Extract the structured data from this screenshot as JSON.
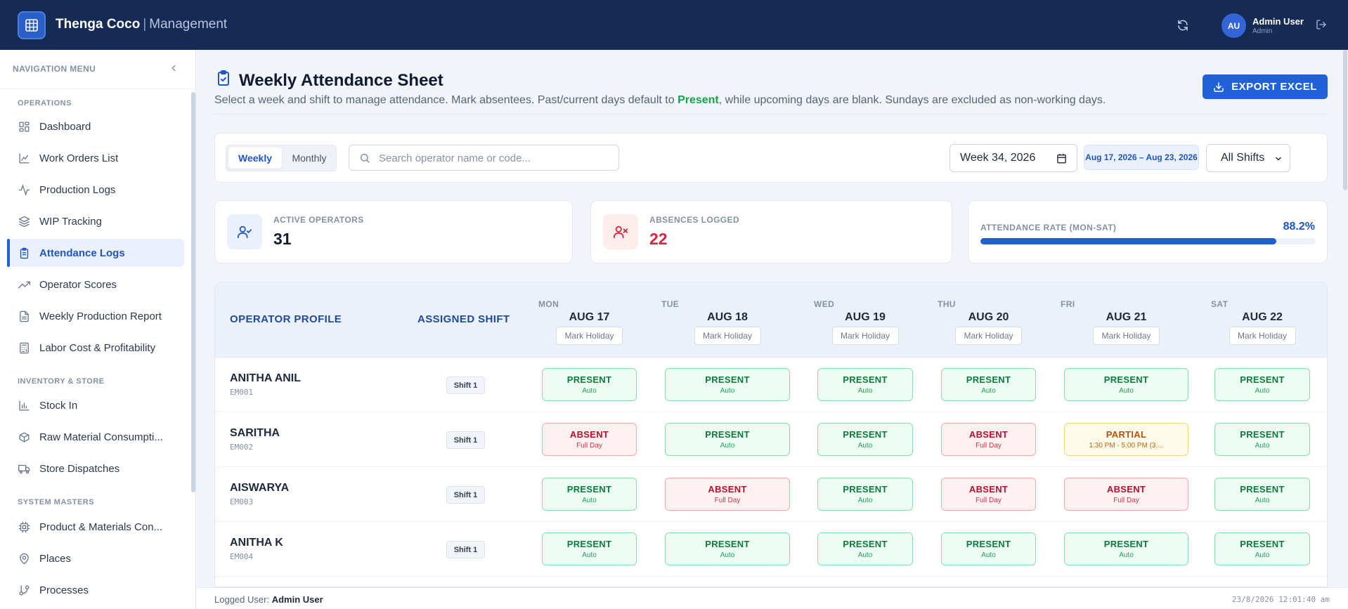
{
  "header": {
    "brand": "Thenga Coco",
    "separator": "|",
    "subtitle": "Management",
    "user_initials": "AU",
    "user_name": "Admin User",
    "user_role": "Admin"
  },
  "sidebar": {
    "title": "NAVIGATION MENU",
    "sections": {
      "operations": "OPERATIONS",
      "inventory": "INVENTORY & STORE",
      "masters": "SYSTEM MASTERS"
    },
    "items": [
      {
        "label": "Dashboard",
        "icon": "dashboard-icon"
      },
      {
        "label": "Work Orders List",
        "icon": "chart-area-icon"
      },
      {
        "label": "Production Logs",
        "icon": "activity-icon"
      },
      {
        "label": "WIP Tracking",
        "icon": "layers-icon"
      },
      {
        "label": "Attendance Logs",
        "icon": "clipboard-icon",
        "active": true
      },
      {
        "label": "Operator Scores",
        "icon": "trending-up-icon"
      },
      {
        "label": "Weekly Production Report",
        "icon": "file-text-icon"
      },
      {
        "label": "Labor Cost & Profitability",
        "icon": "calculator-icon"
      },
      {
        "label": "Stock In",
        "icon": "bar-chart-icon"
      },
      {
        "label": "Raw Material Consumpti...",
        "icon": "package-icon"
      },
      {
        "label": "Store Dispatches",
        "icon": "truck-icon"
      },
      {
        "label": "Product & Materials Con...",
        "icon": "cpu-icon"
      },
      {
        "label": "Places",
        "icon": "map-pin-icon"
      },
      {
        "label": "Processes",
        "icon": "git-branch-icon"
      }
    ]
  },
  "page": {
    "title": "Weekly Attendance Sheet",
    "desc_pre": "Select a week and shift to manage attendance. Mark absentees. Past/current days default to ",
    "desc_highlight": "Present",
    "desc_post": ", while upcoming days are blank. Sundays are excluded as non-working days.",
    "export_label": "EXPORT EXCEL"
  },
  "filters": {
    "view_weekly": "Weekly",
    "view_monthly": "Monthly",
    "search_placeholder": "Search operator name or code...",
    "week_value": "Week 34, 2026",
    "date_range": "Aug 17, 2026 – Aug 23, 2026",
    "shift_value": "All Shifts"
  },
  "stats": {
    "active_label": "ACTIVE OPERATORS",
    "active_value": "31",
    "absences_label": "ABSENCES LOGGED",
    "absences_value": "22",
    "rate_label": "ATTENDANCE RATE (MON-SAT)",
    "rate_value": "88.2%",
    "rate_fraction": 0.882
  },
  "table": {
    "col_operator": "OPERATOR PROFILE",
    "col_shift": "ASSIGNED SHIFT",
    "holiday_label": "Mark Holiday",
    "days": [
      {
        "name": "MON",
        "date": "AUG 17"
      },
      {
        "name": "TUE",
        "date": "AUG 18"
      },
      {
        "name": "WED",
        "date": "AUG 19"
      },
      {
        "name": "THU",
        "date": "AUG 20"
      },
      {
        "name": "FRI",
        "date": "AUG 21"
      },
      {
        "name": "SAT",
        "date": "AUG 22"
      }
    ],
    "rows": [
      {
        "name": "ANITHA ANIL",
        "code": "EM001",
        "shift": "Shift 1",
        "cells": [
          {
            "status": "PRESENT",
            "note": "Auto",
            "kind": "present"
          },
          {
            "status": "PRESENT",
            "note": "Auto",
            "kind": "present"
          },
          {
            "status": "PRESENT",
            "note": "Auto",
            "kind": "present"
          },
          {
            "status": "PRESENT",
            "note": "Auto",
            "kind": "present"
          },
          {
            "status": "PRESENT",
            "note": "Auto",
            "kind": "present"
          },
          {
            "status": "PRESENT",
            "note": "Auto",
            "kind": "present"
          }
        ]
      },
      {
        "name": "SARITHA",
        "code": "EM002",
        "shift": "Shift 1",
        "cells": [
          {
            "status": "ABSENT",
            "note": "Full Day",
            "kind": "absent"
          },
          {
            "status": "PRESENT",
            "note": "Auto",
            "kind": "present"
          },
          {
            "status": "PRESENT",
            "note": "Auto",
            "kind": "present"
          },
          {
            "status": "ABSENT",
            "note": "Full Day",
            "kind": "absent"
          },
          {
            "status": "PARTIAL",
            "note": "1:30 PM - 5:00 PM (3....",
            "kind": "partial"
          },
          {
            "status": "PRESENT",
            "note": "Auto",
            "kind": "present"
          }
        ]
      },
      {
        "name": "AISWARYA",
        "code": "EM003",
        "shift": "Shift 1",
        "cells": [
          {
            "status": "PRESENT",
            "note": "Auto",
            "kind": "present"
          },
          {
            "status": "ABSENT",
            "note": "Full Day",
            "kind": "absent"
          },
          {
            "status": "PRESENT",
            "note": "Auto",
            "kind": "present"
          },
          {
            "status": "ABSENT",
            "note": "Full Day",
            "kind": "absent"
          },
          {
            "status": "ABSENT",
            "note": "Full Day",
            "kind": "absent"
          },
          {
            "status": "PRESENT",
            "note": "Auto",
            "kind": "present"
          }
        ]
      },
      {
        "name": "ANITHA K",
        "code": "EM004",
        "shift": "Shift 1",
        "cells": [
          {
            "status": "PRESENT",
            "note": "Auto",
            "kind": "present"
          },
          {
            "status": "PRESENT",
            "note": "Auto",
            "kind": "present"
          },
          {
            "status": "PRESENT",
            "note": "Auto",
            "kind": "present"
          },
          {
            "status": "PRESENT",
            "note": "Auto",
            "kind": "present"
          },
          {
            "status": "PRESENT",
            "note": "Auto",
            "kind": "present"
          },
          {
            "status": "PRESENT",
            "note": "Auto",
            "kind": "present"
          }
        ]
      }
    ]
  },
  "footer": {
    "user_label": "Logged User:",
    "user_value": "Admin User",
    "timestamp": "23/8/2026 12:01:40 am"
  },
  "colors": {
    "navbar": "#152a55",
    "accent": "#2061d9",
    "present": "#0f7a3b",
    "absent": "#b4122b",
    "partial": "#b45309"
  }
}
